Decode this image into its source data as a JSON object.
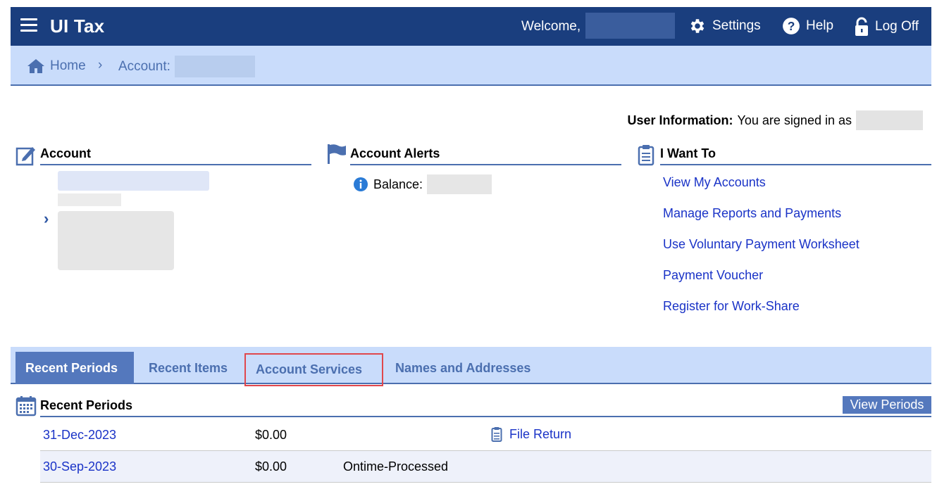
{
  "header": {
    "app_title": "UI Tax",
    "welcome": "Welcome,",
    "settings": "Settings",
    "help": "Help",
    "logoff": "Log Off"
  },
  "breadcrumb": {
    "home": "Home",
    "separator": "›",
    "account_label": "Account:"
  },
  "user_info": {
    "label": "User Information:",
    "text": "You are signed in as"
  },
  "panels": {
    "account_title": "Account",
    "alerts_title": "Account Alerts",
    "balance_label": "Balance:",
    "iwant_title": "I Want To",
    "iwant_links": [
      "View My Accounts",
      "Manage Reports and Payments",
      "Use Voluntary Payment Worksheet",
      "Payment Voucher",
      "Register for Work-Share"
    ]
  },
  "tabs": [
    "Recent Periods",
    "Recent Items",
    "Account Services",
    "Names and Addresses"
  ],
  "recent_periods": {
    "title": "Recent Periods",
    "view_button": "View Periods",
    "rows": [
      {
        "date": "31-Dec-2023",
        "amount": "$0.00",
        "status": "",
        "action": "File Return"
      },
      {
        "date": "30-Sep-2023",
        "amount": "$0.00",
        "status": "Ontime-Processed",
        "action": ""
      }
    ]
  },
  "colors": {
    "header_bg": "#1a3e7e",
    "breadcrumb_bg": "#c9dcfb",
    "link": "#1a33c7",
    "tab_active": "#5478bd",
    "highlight_box": "#e0474c"
  }
}
